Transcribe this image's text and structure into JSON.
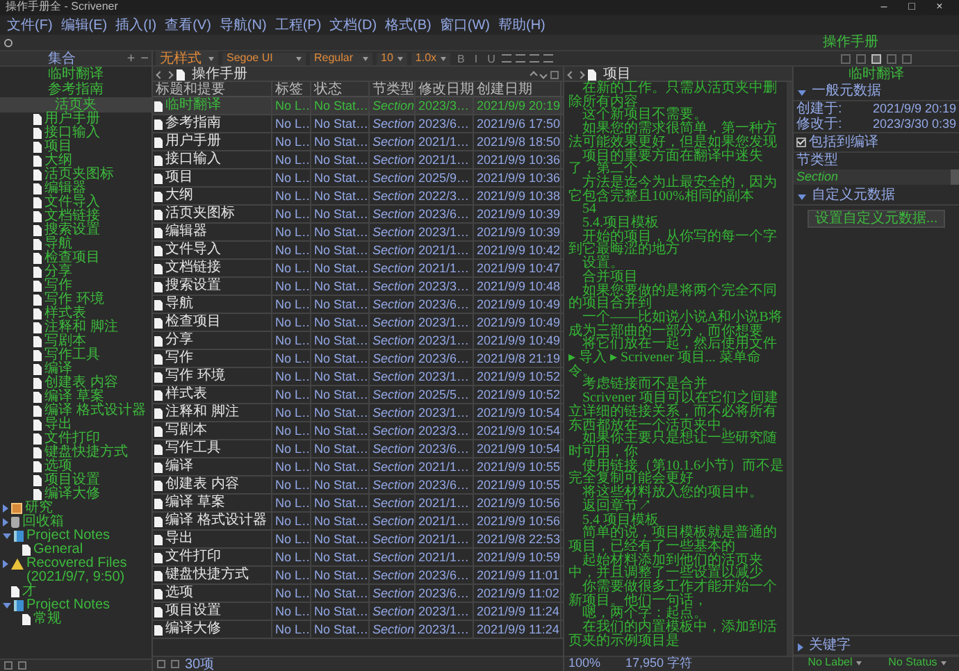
{
  "window": {
    "title": "操作手册全 - Scrivener",
    "controls": [
      "–",
      "□",
      "×"
    ]
  },
  "menu": [
    "文件(F)",
    "编辑(E)",
    "插入(I)",
    "查看(V)",
    "导航(N)",
    "工程(P)",
    "文档(D)",
    "格式(B)",
    "窗口(W)",
    "帮助(H)"
  ],
  "toolbar": {
    "document_label": "操作手册"
  },
  "binder": {
    "header": "集合",
    "header_buttons": [
      "+",
      "−"
    ],
    "collections": [
      {
        "label": "临时翻译",
        "selected": false
      },
      {
        "label": "参考指南",
        "selected": false
      },
      {
        "label": "活页夹",
        "selected": true
      }
    ],
    "tree": [
      {
        "children": [
          {
            "children": [
              {
                "label": "用户手册",
                "kind": "doc"
              },
              {
                "label": "接口输入",
                "kind": "doc"
              },
              {
                "label": "项目",
                "kind": "doc"
              },
              {
                "label": "大纲",
                "kind": "doc"
              },
              {
                "label": "活页夹图标",
                "kind": "doc"
              },
              {
                "label": "编辑器",
                "kind": "doc"
              },
              {
                "label": "文件导入",
                "kind": "doc"
              },
              {
                "label": "文档链接",
                "kind": "doc"
              },
              {
                "label": "搜索设置",
                "kind": "doc"
              },
              {
                "label": "导航",
                "kind": "doc"
              },
              {
                "label": "检查项目",
                "kind": "doc"
              },
              {
                "label": "分享",
                "kind": "doc"
              },
              {
                "label": "写作",
                "kind": "doc"
              },
              {
                "label": "写作 环境",
                "kind": "doc"
              },
              {
                "label": "样式表",
                "kind": "doc"
              },
              {
                "label": "注释和 脚注",
                "kind": "doc"
              },
              {
                "label": "写剧本",
                "kind": "doc"
              },
              {
                "label": "写作工具",
                "kind": "doc"
              },
              {
                "label": "编译",
                "kind": "doc"
              },
              {
                "label": "创建表 内容",
                "kind": "doc"
              },
              {
                "label": "编译 草案",
                "kind": "doc"
              },
              {
                "label": "编译 格式设计器",
                "kind": "doc"
              },
              {
                "label": "导出",
                "kind": "doc"
              },
              {
                "label": "文件打印",
                "kind": "doc"
              },
              {
                "label": "键盘快捷方式",
                "kind": "doc"
              },
              {
                "label": "选项",
                "kind": "doc"
              },
              {
                "label": "项目设置",
                "kind": "doc"
              },
              {
                "label": "编译大修",
                "kind": "doc"
              }
            ]
          }
        ]
      },
      {
        "label": "研究",
        "kind": "research",
        "expanded": false
      },
      {
        "label": "回收箱",
        "kind": "trash",
        "expanded": false
      },
      {
        "label": "Project Notes",
        "kind": "notebook",
        "expanded": true,
        "children": [
          {
            "label": "General",
            "kind": "doc"
          }
        ]
      },
      {
        "label": "Recovered Files (2021/9/7, 9:50)",
        "kind": "warning",
        "expanded": false
      },
      {
        "label": "才",
        "kind": "doc"
      },
      {
        "label": "Project Notes",
        "kind": "notebook",
        "expanded": true,
        "children": [
          {
            "label": "常规",
            "kind": "doc"
          }
        ]
      }
    ]
  },
  "format_bar": {
    "style": "无样式",
    "font": "Segoe UI",
    "weight": "Regular",
    "size": "10",
    "spacing": "1.0x",
    "buttons": [
      "B",
      "I",
      "U"
    ]
  },
  "outline": {
    "title": "操作手册",
    "columns": [
      "标题和提要",
      "标签",
      "状态",
      "节类型",
      "修改日期",
      "创建日期"
    ],
    "rows": [
      {
        "title": "临时翻译",
        "label": "No L…",
        "status": "No Stat…",
        "type": "Section",
        "modified": "2023/3…",
        "created": "2021/9/9 20:19",
        "selected": true
      },
      {
        "title": "参考指南",
        "label": "No L…",
        "status": "No Stat…",
        "type": "Section",
        "modified": "2023/6…",
        "created": "2021/9/6 17:50",
        "selected": false
      },
      {
        "title": "用户手册",
        "label": "No L…",
        "status": "No Stat…",
        "type": "Section",
        "modified": "2021/1…",
        "created": "2021/9/8 18:50",
        "selected": false
      },
      {
        "title": "接口输入",
        "label": "No L…",
        "status": "No Stat…",
        "type": "Section",
        "modified": "2021/1…",
        "created": "2021/9/9 10:36",
        "selected": false
      },
      {
        "title": "项目",
        "label": "No L…",
        "status": "No Stat…",
        "type": "Section",
        "modified": "2025/9…",
        "created": "2021/9/9 10:36",
        "selected": false
      },
      {
        "title": "大纲",
        "label": "No L…",
        "status": "No Stat…",
        "type": "Section",
        "modified": "2022/3…",
        "created": "2021/9/9 10:38",
        "selected": false
      },
      {
        "title": "活页夹图标",
        "label": "No L…",
        "status": "No Stat…",
        "type": "Section",
        "modified": "2023/6…",
        "created": "2021/9/9 10:39",
        "selected": false
      },
      {
        "title": "编辑器",
        "label": "No L…",
        "status": "No Stat…",
        "type": "Section",
        "modified": "2023/1…",
        "created": "2021/9/9 10:39",
        "selected": false
      },
      {
        "title": "文件导入",
        "label": "No L…",
        "status": "No Stat…",
        "type": "Section",
        "modified": "2021/1…",
        "created": "2021/9/9 10:42",
        "selected": false
      },
      {
        "title": "文档链接",
        "label": "No L…",
        "status": "No Stat…",
        "type": "Section",
        "modified": "2021/1…",
        "created": "2021/9/9 10:47",
        "selected": false
      },
      {
        "title": "搜索设置",
        "label": "No L…",
        "status": "No Stat…",
        "type": "Section",
        "modified": "2023/3…",
        "created": "2021/9/9 10:48",
        "selected": false
      },
      {
        "title": "导航",
        "label": "No L…",
        "status": "No Stat…",
        "type": "Section",
        "modified": "2023/6…",
        "created": "2021/9/9 10:49",
        "selected": false
      },
      {
        "title": "检查项目",
        "label": "No L…",
        "status": "No Stat…",
        "type": "Section",
        "modified": "2023/1…",
        "created": "2021/9/9 10:49",
        "selected": false
      },
      {
        "title": "分享",
        "label": "No L…",
        "status": "No Stat…",
        "type": "Section",
        "modified": "2023/1…",
        "created": "2021/9/9 10:49",
        "selected": false
      },
      {
        "title": "写作",
        "label": "No L…",
        "status": "No Stat…",
        "type": "Section",
        "modified": "2023/6…",
        "created": "2021/9/8 21:19",
        "selected": false
      },
      {
        "title": "写作 环境",
        "label": "No L…",
        "status": "No Stat…",
        "type": "Section",
        "modified": "2023/1…",
        "created": "2021/9/9 10:52",
        "selected": false
      },
      {
        "title": "样式表",
        "label": "No L…",
        "status": "No Stat…",
        "type": "Section",
        "modified": "2025/5…",
        "created": "2021/9/9 10:52",
        "selected": false
      },
      {
        "title": "注释和 脚注",
        "label": "No L…",
        "status": "No Stat…",
        "type": "Section",
        "modified": "2023/1…",
        "created": "2021/9/9 10:54",
        "selected": false
      },
      {
        "title": "写剧本",
        "label": "No L…",
        "status": "No Stat…",
        "type": "Section",
        "modified": "2023/3…",
        "created": "2021/9/9 10:54",
        "selected": false
      },
      {
        "title": "写作工具",
        "label": "No L…",
        "status": "No Stat…",
        "type": "Section",
        "modified": "2023/6…",
        "created": "2021/9/9 10:54",
        "selected": false
      },
      {
        "title": "编译",
        "label": "No L…",
        "status": "No Stat…",
        "type": "Section",
        "modified": "2021/1…",
        "created": "2021/9/9 10:55",
        "selected": false
      },
      {
        "title": "创建表 内容",
        "label": "No L…",
        "status": "No Stat…",
        "type": "Section",
        "modified": "2023/6…",
        "created": "2021/9/9 10:55",
        "selected": false
      },
      {
        "title": "编译 草案",
        "label": "No L…",
        "status": "No Stat…",
        "type": "Section",
        "modified": "2021/1…",
        "created": "2021/9/9 10:56",
        "selected": false
      },
      {
        "title": "编译 格式设计器",
        "label": "No L…",
        "status": "No Stat…",
        "type": "Section",
        "modified": "2021/1…",
        "created": "2021/9/9 10:56",
        "selected": false
      },
      {
        "title": "导出",
        "label": "No L…",
        "status": "No Stat…",
        "type": "Section",
        "modified": "2021/1…",
        "created": "2021/9/8 22:53",
        "selected": false
      },
      {
        "title": "文件打印",
        "label": "No L…",
        "status": "No Stat…",
        "type": "Section",
        "modified": "2021/1…",
        "created": "2021/9/9 10:59",
        "selected": false
      },
      {
        "title": "键盘快捷方式",
        "label": "No L…",
        "status": "No Stat…",
        "type": "Section",
        "modified": "2023/6…",
        "created": "2021/9/9 11:01",
        "selected": false
      },
      {
        "title": "选项",
        "label": "No L…",
        "status": "No Stat…",
        "type": "Section",
        "modified": "2023/6…",
        "created": "2021/9/9 11:02",
        "selected": false
      },
      {
        "title": "项目设置",
        "label": "No L…",
        "status": "No Stat…",
        "type": "Section",
        "modified": "2023/1…",
        "created": "2021/9/9 11:24",
        "selected": false
      },
      {
        "title": "编译大修",
        "label": "No L…",
        "status": "No Stat…",
        "type": "Section",
        "modified": "2023/1…",
        "created": "2021/9/9 11:24",
        "selected": false
      }
    ],
    "item_count": "30项"
  },
  "editor": {
    "title": "项目",
    "paragraphs": [
      "在新的工作。只需从活页夹中删除所有内容",
      "这个新项目不需要。",
      "如果您的需求很简单，第一种方法可能效果更好，但是如果您发现",
      "项目的重要方面在翻译中迷失了，第二个",
      "方法是迄今为止最安全的，因为它包含完整且100%相同的副本",
      "54",
      "5.4.项目模板",
      "开始的项目，从你写的每一个字到它最晦涩的地方",
      "设置。",
      "合并项目",
      "如果您要做的是将两个完全不同的项目合并到",
      "一个——比如说小说A和小说B将成为三部曲的一部分，而你想要",
      "将它们放在一起，然后使用文件 ▸ 导入 ▸ Scrivener 项目... 菜单命令。",
      "考虑链接而不是合并",
      "Scrivener 项目可以在它们之间建立详细的链接关系，而不必将所有东西都放在一个活页夹中。",
      "如果你主要只是想让一些研究随时可用，你",
      "使用链接（第10.1.6小节）而不是完全复制可能会更好",
      "将这些材料放入您的项目中。",
      "返回章节↗",
      "5.4 项目模板",
      "简单的说，项目模板就是普通的项目，已经有了一些基本的",
      "起始材料添加到他们的活页夹中，并且调整了一些设置以减少",
      "你需要做很多工作才能开始一个新项目。他们一句话，",
      "嗯，两个字：起点。",
      "在我们的内置模板中，添加到活页夹的示例项目是"
    ],
    "zoom": "100%",
    "char_count": "17,950 字符"
  },
  "inspector": {
    "tabs": [
      {
        "selected": false
      },
      {
        "selected": false
      },
      {
        "selected": true
      },
      {
        "selected": false
      },
      {
        "selected": false
      }
    ],
    "title": "临时翻译",
    "general": {
      "heading": "一般元数据",
      "expanded": true,
      "created_label": "创建于:",
      "created": "2021/9/9 20:19",
      "modified_label": "修改于:",
      "modified": "2023/3/30 0:39"
    },
    "include": {
      "label": "包括到编译",
      "checked": true
    },
    "section_type": {
      "label": "节类型",
      "value": "Section"
    },
    "custom": {
      "heading": "自定义元数据",
      "expanded": true,
      "button": "设置自定义元数据..."
    },
    "keywords": {
      "heading": "关键字",
      "expanded": false
    },
    "footer": [
      "No Label",
      "No Status"
    ]
  }
}
